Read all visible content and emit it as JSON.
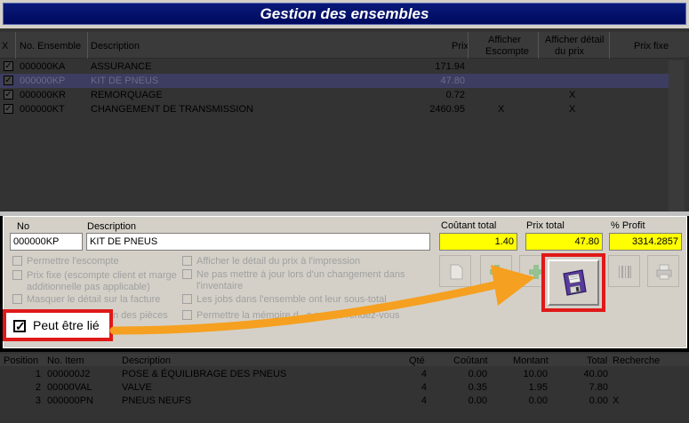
{
  "window": {
    "title": "Gestion des ensembles"
  },
  "ensembles": {
    "headers": {
      "check": "X",
      "no": "No. Ensemble",
      "description": "Description",
      "prix": "Prix",
      "afficher_escompte": [
        "Afficher",
        "Escompte"
      ],
      "afficher_detail": [
        "Afficher détail",
        "du prix"
      ],
      "prix_fixe": "Prix fixe"
    },
    "rows": [
      {
        "checked": true,
        "no": "000000KA",
        "description": "ASSURANCE",
        "prix": "171.94",
        "escompte": "",
        "detail": "",
        "selected": false
      },
      {
        "checked": true,
        "no": "000000KP",
        "description": "KIT DE PNEUS",
        "prix": "47.80",
        "escompte": "",
        "detail": "",
        "selected": true
      },
      {
        "checked": true,
        "no": "000000KR",
        "description": "REMORQUAGE",
        "prix": "0.72",
        "escompte": "",
        "detail": "X",
        "selected": false
      },
      {
        "checked": true,
        "no": "000000KT",
        "description": "CHANGEMENT DE TRANSMISSION",
        "prix": "2460.95",
        "escompte": "X",
        "detail": "X",
        "selected": false
      }
    ]
  },
  "detail": {
    "no_label": "No",
    "no_value": "000000KP",
    "description_label": "Description",
    "description_value": "KIT DE PNEUS",
    "cout_label": "Coûtant total",
    "cout_value": "1.40",
    "prix_label": "Prix total",
    "prix_value": "47.80",
    "profit_label": "% Profit",
    "profit_value": "3314.2857",
    "options_left": [
      [
        "Permettre l'escompte"
      ],
      [
        "Prix fixe (escompte client et marge",
        "additionnelle  pas applicable)"
      ],
      [
        "Masquer le détail sur la facture"
      ],
      [
        "n des pièces"
      ]
    ],
    "options_right": [
      [
        "Afficher le détail du prix à l'impression"
      ],
      [
        "Ne pas mettre à jour lors d'un changement dans",
        "l'inventaire"
      ],
      [
        "Les jobs dans l'ensemble ont leur sous-total"
      ],
      [
        "Permettre la mémoire d",
        "s sur les rendez-vous"
      ]
    ],
    "peut_etre_lie": "Peut être lié"
  },
  "items": {
    "headers": {
      "position": "Position",
      "no_item": "No. Item",
      "description": "Description",
      "qte": "Qté",
      "coutant": "Coûtant",
      "montant": "Montant",
      "total": "Total",
      "recherche": "Recherche"
    },
    "rows": [
      {
        "position": "1",
        "no_item": "000000J2",
        "description": "POSE & ÉQUILIBRAGE DES PNEUS",
        "qte": "4",
        "coutant": "0.00",
        "montant": "10.00",
        "total": "40.00",
        "recherche": ""
      },
      {
        "position": "2",
        "no_item": "00000VAL",
        "description": "VALVE",
        "qte": "4",
        "coutant": "0.35",
        "montant": "1.95",
        "total": "7.80",
        "recherche": ""
      },
      {
        "position": "3",
        "no_item": "000000PN",
        "description": "PNEUS NEUFS",
        "qte": "4",
        "coutant": "0.00",
        "montant": "0.00",
        "total": "0.00",
        "recherche": "X"
      }
    ]
  },
  "colors": {
    "highlight": "#e01818",
    "arrow": "#f5a020",
    "total_fields": "#ffff00"
  }
}
